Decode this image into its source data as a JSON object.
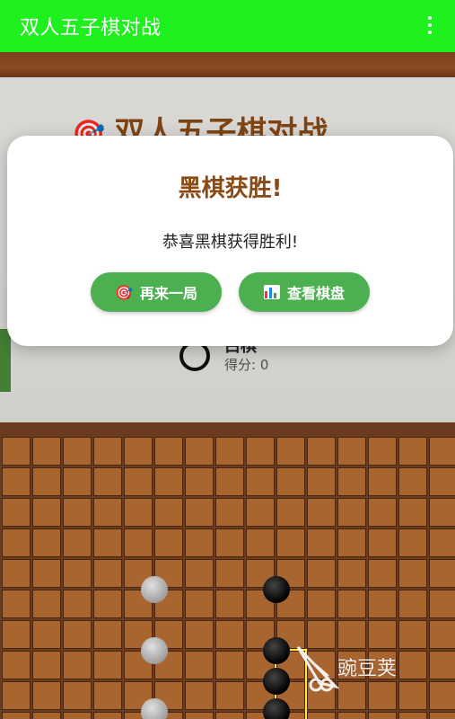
{
  "appbar": {
    "title": "双人五子棋对战",
    "menu_icon": "more-vert-icon"
  },
  "background": {
    "title": "双人五子棋对战",
    "title_icon": "🎯",
    "player": {
      "name": "白棋",
      "score": "得分: 0",
      "stone": "white"
    }
  },
  "dialog": {
    "title": "黑棋获胜!",
    "message": "恭喜黑棋获得胜利!",
    "replay_label": "再来一局",
    "replay_icon": "🎯",
    "view_label": "查看棋盘",
    "view_icon": "bar-chart-icon"
  },
  "board": {
    "stones": [
      {
        "col": 5,
        "row": 5,
        "color": "white"
      },
      {
        "col": 5,
        "row": 7,
        "color": "white"
      },
      {
        "col": 5,
        "row": 9,
        "color": "white"
      },
      {
        "col": 9,
        "row": 5,
        "color": "black"
      },
      {
        "col": 9,
        "row": 7,
        "color": "black"
      },
      {
        "col": 9,
        "row": 8,
        "color": "black"
      },
      {
        "col": 9,
        "row": 9,
        "color": "black"
      }
    ],
    "winning_line": {
      "col": 9,
      "row_start": 7,
      "row_end": 9
    }
  },
  "watermark": {
    "text": "豌豆荚"
  },
  "colors": {
    "appbar": "#1ef01e",
    "button": "#4caf50",
    "title": "#8a4a15",
    "board_cell": "#a86530"
  }
}
